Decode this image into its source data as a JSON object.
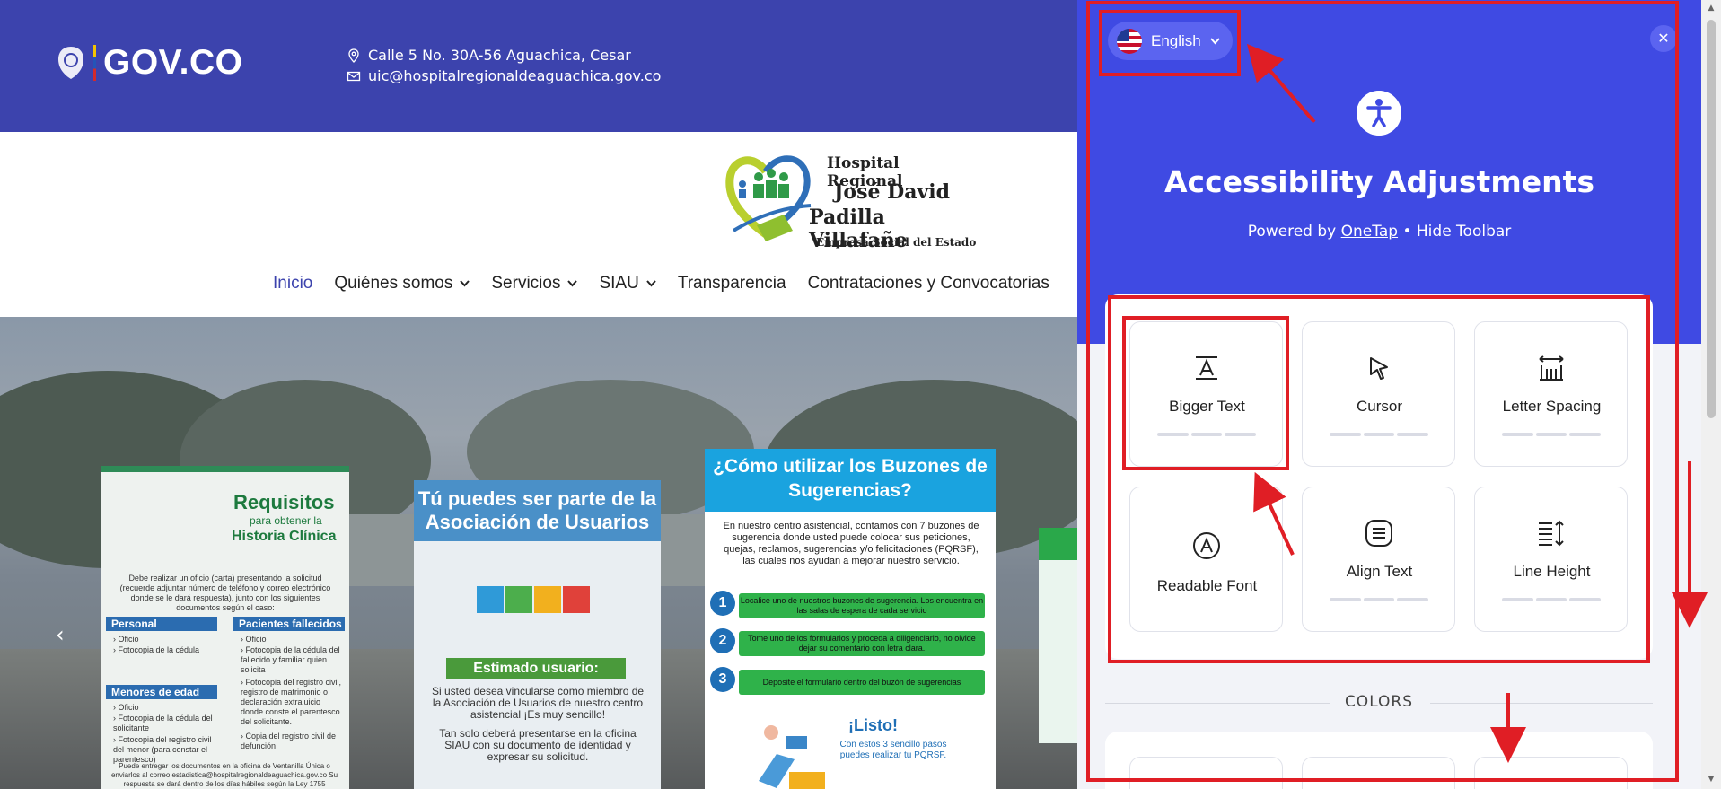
{
  "site": {
    "govco_logo_text": "GOV.CO",
    "address": "Calle 5 No. 30A-56 Aguachica, Cesar",
    "email": "uic@hospitalregionaldeaguachica.gov.co",
    "logo": {
      "line1": "Hospital Regional",
      "line2": "José David",
      "line3": "Padilla Villafañe",
      "line4": "Empresa Social del Estado"
    },
    "nav": [
      {
        "label": "Inicio",
        "active": true,
        "dropdown": false
      },
      {
        "label": "Quiénes somos",
        "active": false,
        "dropdown": true
      },
      {
        "label": "Servicios",
        "active": false,
        "dropdown": true
      },
      {
        "label": "SIAU",
        "active": false,
        "dropdown": true
      },
      {
        "label": "Transparencia",
        "active": false,
        "dropdown": false
      },
      {
        "label": "Contrataciones y Convocatorias",
        "active": false,
        "dropdown": false
      }
    ],
    "slides": {
      "card1": {
        "title": "Requisitos",
        "subtitle": "para obtener la",
        "title2": "Historia Clínica",
        "intro": "Debe realizar un oficio (carta) presentando la solicitud (recuerde adjuntar número de teléfono y correo electrónico donde se le dará respuesta), junto con los siguientes documentos según el caso:",
        "personal": "Personal",
        "fallecidos": "Pacientes fallecidos",
        "menores": "Menores de edad",
        "personal_items": [
          "Oficio",
          "Fotocopia de la cédula"
        ],
        "menores_items": [
          "Oficio",
          "Fotocopia de la cédula del solicitante",
          "Fotocopia del registro civil del menor (para constar el parentesco)"
        ],
        "fallecidos_items": [
          "Oficio",
          "Fotocopia de la cédula del fallecido y familiar quien solicita",
          "Fotocopia del registro civil, registro de matrimonio o declaración extrajuicio donde conste el parentesco del solicitante.",
          "Copia del registro civil de defunción"
        ],
        "footer": "Puede entregar los documentos en la oficina de Ventanilla Única o enviarlos al correo estadistica@hospitalregionaldeaguachica.gov.co Su respuesta se dará dentro de los días hábiles según la Ley 1755"
      },
      "card2": {
        "title": "Tú puedes ser parte de la Asociación de Usuarios",
        "band": "Estimado usuario:",
        "text1": "Si usted desea vincularse como miembro de la Asociación de Usuarios de nuestro centro asistencial ¡Es muy sencillo!",
        "text2": "Tan solo deberá presentarse en la oficina SIAU con su documento de identidad y expresar su solicitud."
      },
      "card3": {
        "title": "¿Cómo utilizar los Buzones de Sugerencias?",
        "intro": "En nuestro centro asistencial, contamos con 7 buzones de sugerencia donde usted puede colocar sus peticiones, quejas, reclamos, sugerencias y/o felicitaciones (PQRSF), las cuales nos ayudan a mejorar nuestro servicio.",
        "steps": [
          {
            "n": "1",
            "text": "Localice uno de nuestros buzones de sugerencia. Los encuentra en las salas de espera de cada servicio"
          },
          {
            "n": "2",
            "text": "Tome uno de los formularios y proceda a diligenciarlo, no olvide dejar su comentario con letra clara."
          },
          {
            "n": "3",
            "text": "Deposite el formulario dentro del buzón de sugerencias"
          }
        ],
        "listo": "¡Listo!",
        "listo_sub": "Con estos 3 sencillo pasos puedes realizar tu PQRSF."
      }
    }
  },
  "panel": {
    "language": "English",
    "title": "Accessibility Adjustments",
    "powered_prefix": "Powered by",
    "powered_link": "OneTap",
    "bullet": "•",
    "hide_toolbar": "Hide Toolbar",
    "close": "✕",
    "tiles": [
      {
        "label": "Bigger Text",
        "icon": "bigger-text-icon",
        "dots": true
      },
      {
        "label": "Cursor",
        "icon": "cursor-icon",
        "dots": true
      },
      {
        "label": "Letter Spacing",
        "icon": "letter-spacing-icon",
        "dots": true
      },
      {
        "label": "Readable Font",
        "icon": "readable-font-icon",
        "dots": false
      },
      {
        "label": "Align Text",
        "icon": "align-text-icon",
        "dots": true
      },
      {
        "label": "Line Height",
        "icon": "line-height-icon",
        "dots": true
      }
    ],
    "colors_label": "COLORS"
  },
  "colors": {
    "topbar": "#3c43ad",
    "panel_header": "#3f4ae3",
    "annotation": "#e01e25"
  }
}
